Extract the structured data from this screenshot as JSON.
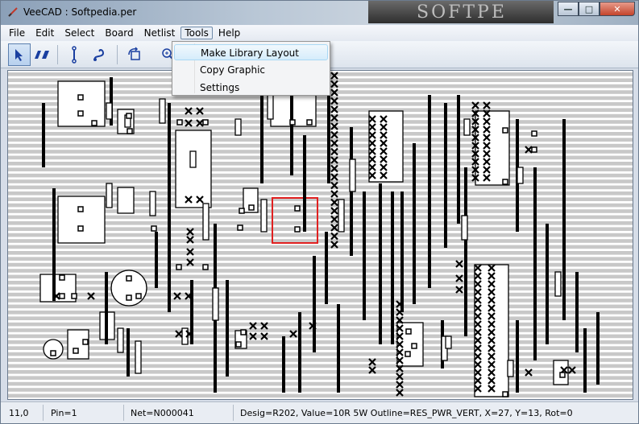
{
  "window": {
    "title": "VeeCAD : Softpedia.per",
    "watermark": "SOFTPE"
  },
  "menu": [
    "File",
    "Edit",
    "Select",
    "Board",
    "Netlist",
    "Tools",
    "Help"
  ],
  "tools_menu": {
    "items": [
      "Make Library Layout",
      "Copy Graphic",
      "Settings"
    ],
    "hovered_index": 0
  },
  "toolbar": {
    "icons": [
      "select-arrow-icon",
      "break-track-icon",
      "link-icon",
      "wire-icon",
      "rotate-icon",
      "zoom-icon"
    ]
  },
  "status": {
    "coords": "11,0",
    "pin": "Pin=1",
    "net": "Net=N000041",
    "desig": "Desig=R202, Value=10R 5W Outline=RES_PWR_VERT, X=27, Y=13, Rot=0"
  },
  "colors": {
    "strip": "#c8c8c8",
    "component": "#000000",
    "selected": "#e02020",
    "titlebar": "#b9c7d6"
  }
}
